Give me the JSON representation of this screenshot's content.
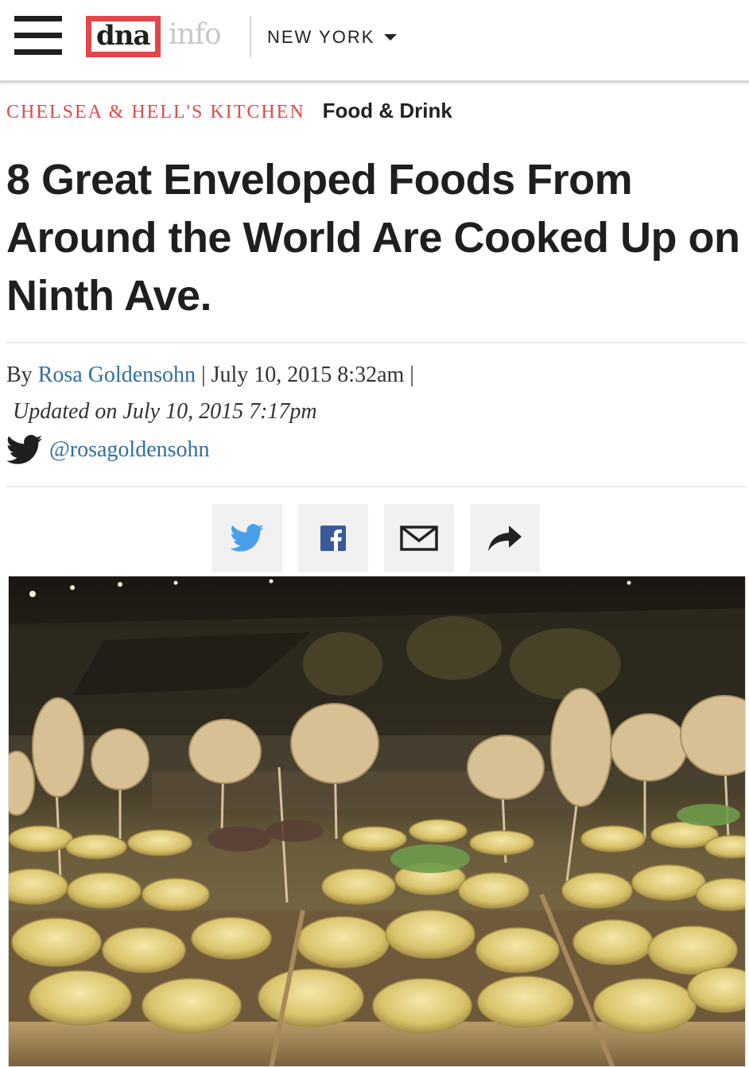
{
  "header": {
    "logo_primary": "dna",
    "logo_secondary": "info",
    "region": "NEW YORK"
  },
  "categories": {
    "neighborhood": "CHELSEA & HELL'S KITCHEN",
    "section": "Food & Drink"
  },
  "article": {
    "headline": "8 Great Enveloped Foods From Around the World Are Cooked Up on Ninth Ave.",
    "byline_prefix": "By ",
    "author": "Rosa Goldensohn",
    "published": " | July 10, 2015 8:32am |",
    "updated": "Updated on July 10, 2015 7:17pm",
    "twitter_handle": "@rosagoldensohn"
  },
  "share": {
    "buttons": [
      "twitter-icon",
      "facebook-icon",
      "email-icon",
      "share-arrow-icon"
    ]
  },
  "colors": {
    "brand_red": "#e2474b",
    "link_blue": "#2f6f9f",
    "twitter_blue": "#4a9fe9",
    "facebook_blue": "#3b5998"
  }
}
